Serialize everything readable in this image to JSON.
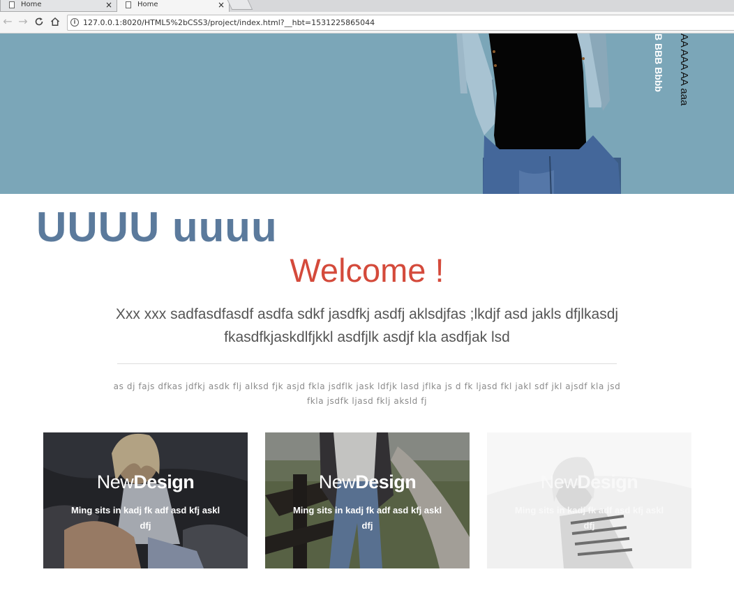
{
  "browser": {
    "tabs": [
      {
        "title": "Home",
        "active": false
      },
      {
        "title": "Home",
        "active": true
      }
    ],
    "close_glyph": "×",
    "url": "127.0.0.1:8020/HTML5%2bCSS3/project/index.html?__hbt=1531225865044"
  },
  "hero": {
    "vertical_bold": "B BBB Bbbb",
    "vertical_light": "AA AAA AA aaa",
    "background": "#7ba6b8"
  },
  "content": {
    "big_title": "UUUU uuuu",
    "welcome": "Welcome !",
    "lead": "Xxx xxx sadfasdfasdf asdfa sdkf jasdfkj asdfj aklsdjfas ;lkdjf asd jakls dfjlkasdj fkasdfkjaskdlfjkkl asdfjlk asdjf kla asdfjak lsd",
    "small": "as dj fajs dfkas jdfkj asdk flj alksd fjk asjd fkla jsdflk jask ldfjk lasd jflka js d fk ljasd fkl jakl sdf jkl ajsdf kla jsd fkla jsdfk ljasd fklj aksld fj"
  },
  "cards": [
    {
      "title_light": "New",
      "title_bold": "Design",
      "desc": "Ming sits in kadj fk adf asd kfj askl dfj"
    },
    {
      "title_light": "New",
      "title_bold": "Design",
      "desc": "Ming sits in kadj fk adf asd kfj askl dfj"
    },
    {
      "title_light": "New",
      "title_bold": "Design",
      "desc": "Ming sits in kadj fk adf asd kfj askl dfj"
    }
  ],
  "colors": {
    "title_blue": "#5b7a9c",
    "welcome_red": "#d44a3b",
    "text_gray": "#555555"
  }
}
